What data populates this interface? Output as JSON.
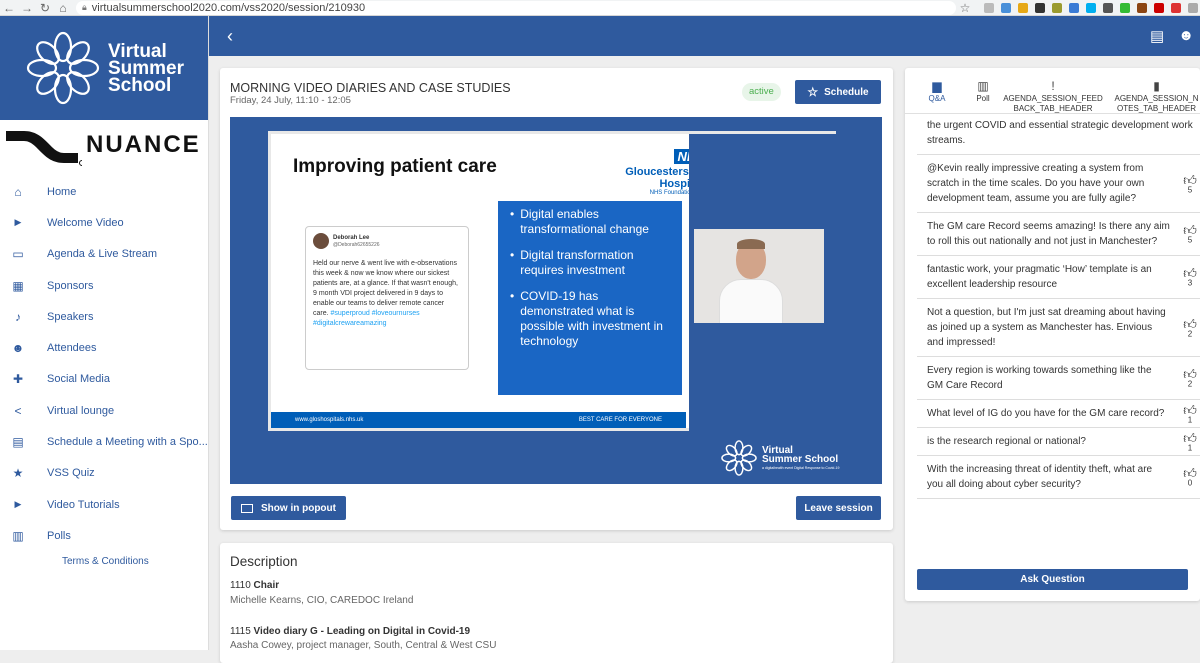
{
  "browser": {
    "url": "virtualsummerschool2020.com/vss2020/session/210930"
  },
  "sidebar": {
    "logo_lines": [
      "Virtual",
      "Summer",
      "School"
    ],
    "sponsor": "NUANCE",
    "items": [
      {
        "label": "Home",
        "icon": "home-icon",
        "glyph": "⌂"
      },
      {
        "label": "Welcome Video",
        "icon": "play-icon",
        "glyph": "▶"
      },
      {
        "label": "Agenda & Live Stream",
        "icon": "live-tv-icon",
        "glyph": "▭"
      },
      {
        "label": "Sponsors",
        "icon": "business-icon",
        "glyph": "▦"
      },
      {
        "label": "Speakers",
        "icon": "microphone-icon",
        "glyph": "♪"
      },
      {
        "label": "Attendees",
        "icon": "people-icon",
        "glyph": "☻"
      },
      {
        "label": "Social Media",
        "icon": "social-icon",
        "glyph": "✚"
      },
      {
        "label": "Virtual lounge",
        "icon": "share-icon",
        "glyph": "<"
      },
      {
        "label": "Schedule a Meeting with a Spo...",
        "icon": "chat-icon",
        "glyph": "▤"
      },
      {
        "label": "VSS Quiz",
        "icon": "star-circle-icon",
        "glyph": "★"
      },
      {
        "label": "Video Tutorials",
        "icon": "video-library-icon",
        "glyph": "▶"
      },
      {
        "label": "Polls",
        "icon": "poll-icon",
        "glyph": "▥"
      }
    ],
    "terms": "Terms & Conditions"
  },
  "session": {
    "title": "MORNING VIDEO DIARIES AND CASE STUDIES",
    "date": "Friday, 24 July, 11:10 - 12:05",
    "status": "active",
    "schedule_label": "Schedule",
    "popout_label": "Show in popout",
    "leave_label": "Leave session"
  },
  "slide": {
    "title": "Improving patient care",
    "nhs_badge": "NHS",
    "nhs_name": "Gloucestershire Hospitals",
    "nhs_sub": "NHS Foundation Trust",
    "tweet_name": "Deborah Lee",
    "tweet_handle": "@Deborah62655226",
    "tweet_body": "Held our nerve & went live with e-observations this week & now we know where our sickest patients are, at a glance. If that wasn't enough, 9 month VDI project delivered in 9 days to enable our teams to deliver remote cancer care.",
    "tweet_tags": "#superproud #loveournurses #digitalcrewareamazing",
    "bullets": [
      "Digital enables transformational change",
      "Digital transformation requires investment",
      "COVID-19 has demonstrated what is possible with investment in technology"
    ],
    "footer_left": "www.gloshospitals.nhs.uk",
    "footer_right": "BEST CARE FOR EVERYONE",
    "watermark_lines": [
      "Virtual",
      "Summer School"
    ],
    "watermark_sub": "a digitalhealth event  Digital Response to Covid-19"
  },
  "description": {
    "heading": "Description",
    "entries": [
      {
        "time": "1110",
        "title": "Chair",
        "person": "Michelle Kearns, CIO, CAREDOC Ireland"
      },
      {
        "time": "1115",
        "title": "Video diary G - Leading on Digital in Covid-19",
        "person": "Aasha Cowey, project manager, South, Central & West CSU"
      }
    ]
  },
  "qa": {
    "tabs": [
      {
        "label": "Q&A",
        "icon": "qa-icon",
        "glyph": "▆"
      },
      {
        "label": "Poll",
        "icon": "poll-icon",
        "glyph": "▥"
      },
      {
        "label": "AGENDA_SESSION_FEEDBACK_TAB_HEADER",
        "icon": "feedback-icon",
        "glyph": "!"
      },
      {
        "label": "AGENDA_SESSION_NOTES_TAB_HEADER",
        "icon": "notes-icon",
        "glyph": "▮"
      }
    ],
    "first_question_tail": "the urgent COVID and essential strategic development work streams.",
    "questions": [
      {
        "text": "@Kevin really impressive creating a system from scratch in the time scales. Do you have your own development team, assume you are fully agile?",
        "votes": "5"
      },
      {
        "text": "The GM care Record seems amazing! Is there any aim to roll this out nationally and not just in Manchester?",
        "votes": "5"
      },
      {
        "text": "fantastic work, your pragmatic ‘How’ template is an excellent leadership resource",
        "votes": "3"
      },
      {
        "text": "Not a question, but I'm just sat dreaming about having as joined up a system as Manchester has. Envious and impressed!",
        "votes": "2"
      },
      {
        "text": "Every region is working towards something like the GM Care Record",
        "votes": "2"
      },
      {
        "text": "What level of IG do you have for the GM care record?",
        "votes": "1"
      },
      {
        "text": "is the research regional or national?",
        "votes": "1"
      },
      {
        "text": "With the increasing threat of identity theft, what are you all doing about cyber security?",
        "votes": "0"
      }
    ],
    "ask_label": "Ask Question"
  }
}
